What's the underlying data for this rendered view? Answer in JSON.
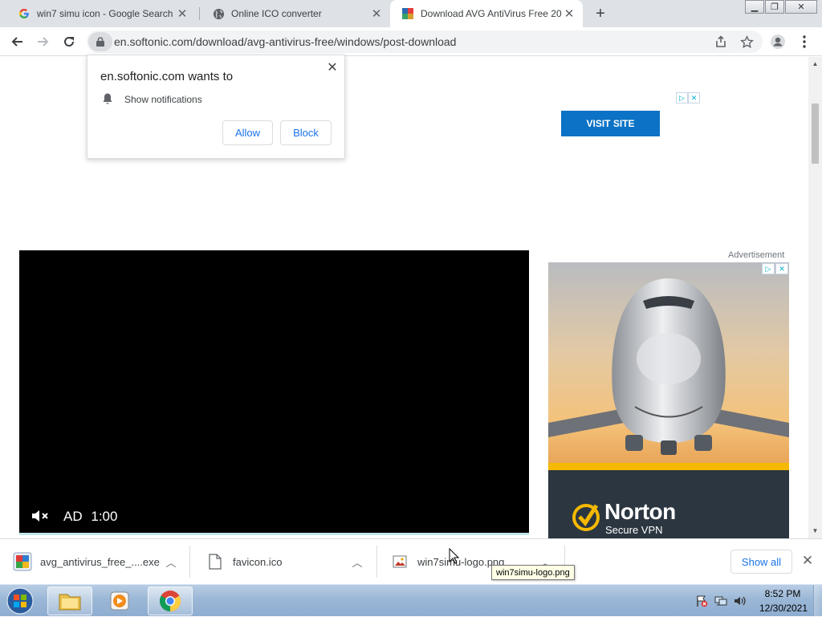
{
  "tabs": [
    {
      "title": "win7 simu icon - Google Search",
      "icon": "google-icon"
    },
    {
      "title": "Online ICO converter",
      "icon": "globe-icon"
    },
    {
      "title": "Download AVG AntiVirus Free 20",
      "icon": "softonic-icon",
      "active": true
    }
  ],
  "toolbar": {
    "url": "en.softonic.com/download/avg-antivirus-free/windows/post-download"
  },
  "permission_prompt": {
    "title": "en.softonic.com wants to",
    "permission": "Show notifications",
    "allow_label": "Allow",
    "block_label": "Block"
  },
  "page": {
    "top_ad_button": "VISIT SITE",
    "ad_label": "Advertisement",
    "video_ad_label": "AD",
    "video_ad_time": "1:00",
    "norton_brand": "Norton",
    "norton_product": "Secure VPN"
  },
  "downloads": [
    {
      "name": "avg_antivirus_free_....exe",
      "icon": "avg-installer-icon"
    },
    {
      "name": "favicon.ico",
      "icon": "file-icon"
    },
    {
      "name": "win7simu-logo.png",
      "icon": "image-file-icon"
    }
  ],
  "download_shelf": {
    "show_all_label": "Show all",
    "tooltip": "win7simu-logo.png"
  },
  "taskbar": {
    "time": "8:52 PM",
    "date": "12/30/2021"
  },
  "colors": {
    "visit_site": "#0b72c5",
    "norton_yellow": "#f5b900",
    "link_blue": "#1a73e8"
  }
}
